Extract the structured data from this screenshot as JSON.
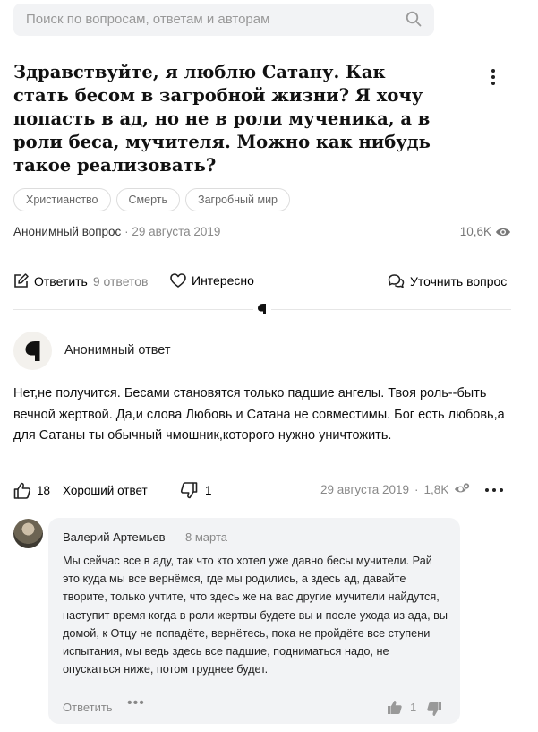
{
  "search": {
    "placeholder": "Поиск по вопросам, ответам и авторам"
  },
  "question": {
    "title": "Здравствуйте, я люблю Сатану. Как стать бесом в загробной жизни? Я хочу попасть в ад, но не в роли мученика, а в роли беса, мучителя. Можно как нибудь такое реализовать?",
    "tags": [
      "Христианство",
      "Смерть",
      "Загробный мир"
    ],
    "author": "Анонимный вопрос",
    "separator": "·",
    "date": "29 августа 2019",
    "views": "10,6K"
  },
  "actions": {
    "answer_label": "Ответить",
    "answer_count": "9 ответов",
    "interesting_label": "Интересно",
    "clarify_label": "Уточнить вопрос"
  },
  "answer": {
    "author": "Анонимный ответ",
    "text": "Нет,не получится. Бесами становятся только падшие ангелы. Твоя роль--быть вечной жертвой. Да,и слова Любовь и Сатана не совместимы. Бог есть любовь,а для Сатаны ты обычный чмошник,которого нужно уничтожить.",
    "likes": "18",
    "good_answer_label": "Хороший ответ",
    "dislikes": "1",
    "date": "29 августа 2019",
    "separator": "·",
    "views": "1,8K"
  },
  "comment": {
    "author": "Валерий Артемьев",
    "date": "8 марта",
    "text": "Мы сейчас все в аду, так что кто хотел уже давно бесы мучители. Рай это куда мы все вернёмся, где мы родились, а здесь ад, давайте творите, только учтите, что здесь же на вас другие мучители найдутся, наступит время когда в роли жертвы будете вы и после ухода из ада, вы домой, к Отцу не попадёте, вернётесь, пока не пройдёте все ступени испытания, мы ведь здесь все падшие, подниматься надо, не опускаться ниже, потом труднее будет.",
    "reply_label": "Ответить",
    "more_label": "•••",
    "likes": "1"
  },
  "colors": {
    "text": "#000000",
    "muted": "#888888",
    "search_bg": "#f2f3f5",
    "bubble_bg": "#f2f3f5"
  },
  "icons": [
    "search-icon",
    "kebab-icon",
    "eye-icon",
    "edit-icon",
    "heart-icon",
    "chat-icon",
    "logo-icon",
    "thumbs-up-icon",
    "thumbs-down-icon",
    "views-settings-icon",
    "more-icon"
  ]
}
